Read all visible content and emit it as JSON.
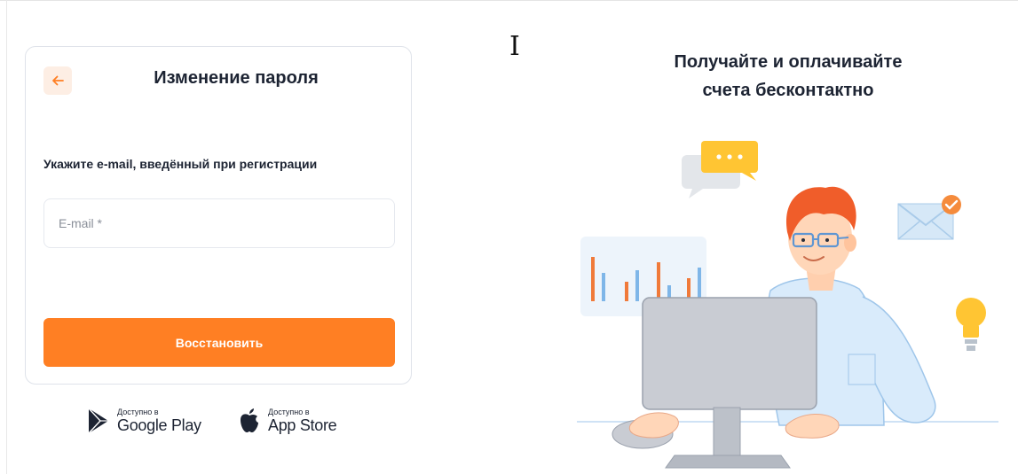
{
  "form": {
    "title": "Изменение пароля",
    "hint": "Укажите e-mail, введённый при регистрации",
    "email_placeholder": "E-mail *",
    "email_value": "",
    "submit_label": "Восстановить"
  },
  "stores": {
    "google": {
      "small": "Доступно в",
      "big": "Google Play"
    },
    "apple": {
      "small": "Доступно в",
      "big": "App Store"
    }
  },
  "promo": {
    "line1": "Получайте и оплачивайте",
    "line2": "счета бесконтактно"
  },
  "colors": {
    "accent": "#ff7f23",
    "accent_soft": "#fdeee4",
    "text": "#1d2433"
  }
}
